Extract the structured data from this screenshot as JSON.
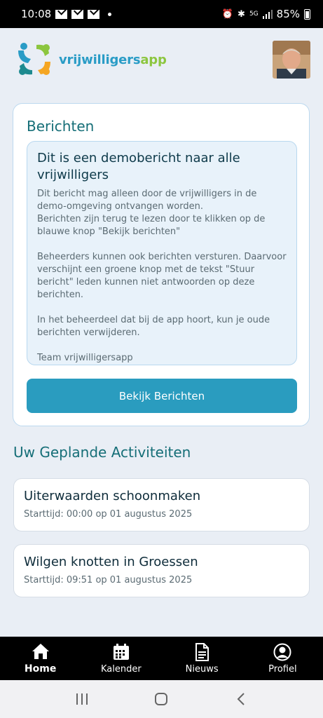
{
  "status_bar": {
    "time": "10:08",
    "battery": "85%",
    "network": "5G"
  },
  "header": {
    "brand_part1": "vrijwilligers",
    "brand_part2": "app"
  },
  "messages": {
    "title": "Berichten",
    "message_title": "Dit is een demobericht naar alle vrijwilligers",
    "message_body": "Dit bericht mag alleen door de vrijwilligers in de demo-omgeving ontvangen worden.\nBerichten zijn terug te lezen door te klikken op de blauwe knop \"Bekijk berichten\"\n\nBeheerders kunnen ook berichten versturen. Daarvoor verschijnt een groene knop met de tekst \"Stuur bericht\" leden kunnen niet antwoorden op deze berichten.\n\nIn het beheerdeel dat bij de app hoort, kun je oude berichten verwijderen.\n\nTeam vrijwilligersapp",
    "button_label": "Bekijk Berichten"
  },
  "activities": {
    "title": "Uw Geplande Activiteiten",
    "items": [
      {
        "title": "Uiterwaarden schoonmaken",
        "time": "Starttijd: 00:00 op 01 augustus 2025"
      },
      {
        "title": "Wilgen knotten in Groessen",
        "time": "Starttijd: 09:51 op 01 augustus 2025"
      }
    ]
  },
  "bottom_nav": {
    "items": [
      {
        "label": "Home",
        "icon": "home-icon"
      },
      {
        "label": "Kalender",
        "icon": "calendar-icon"
      },
      {
        "label": "Nieuws",
        "icon": "document-icon"
      },
      {
        "label": "Profiel",
        "icon": "profile-icon"
      }
    ]
  },
  "colors": {
    "accent": "#2a9cbf",
    "heading": "#156e77",
    "brand_blue": "#2a9cc6",
    "brand_green": "#8cc63f"
  }
}
